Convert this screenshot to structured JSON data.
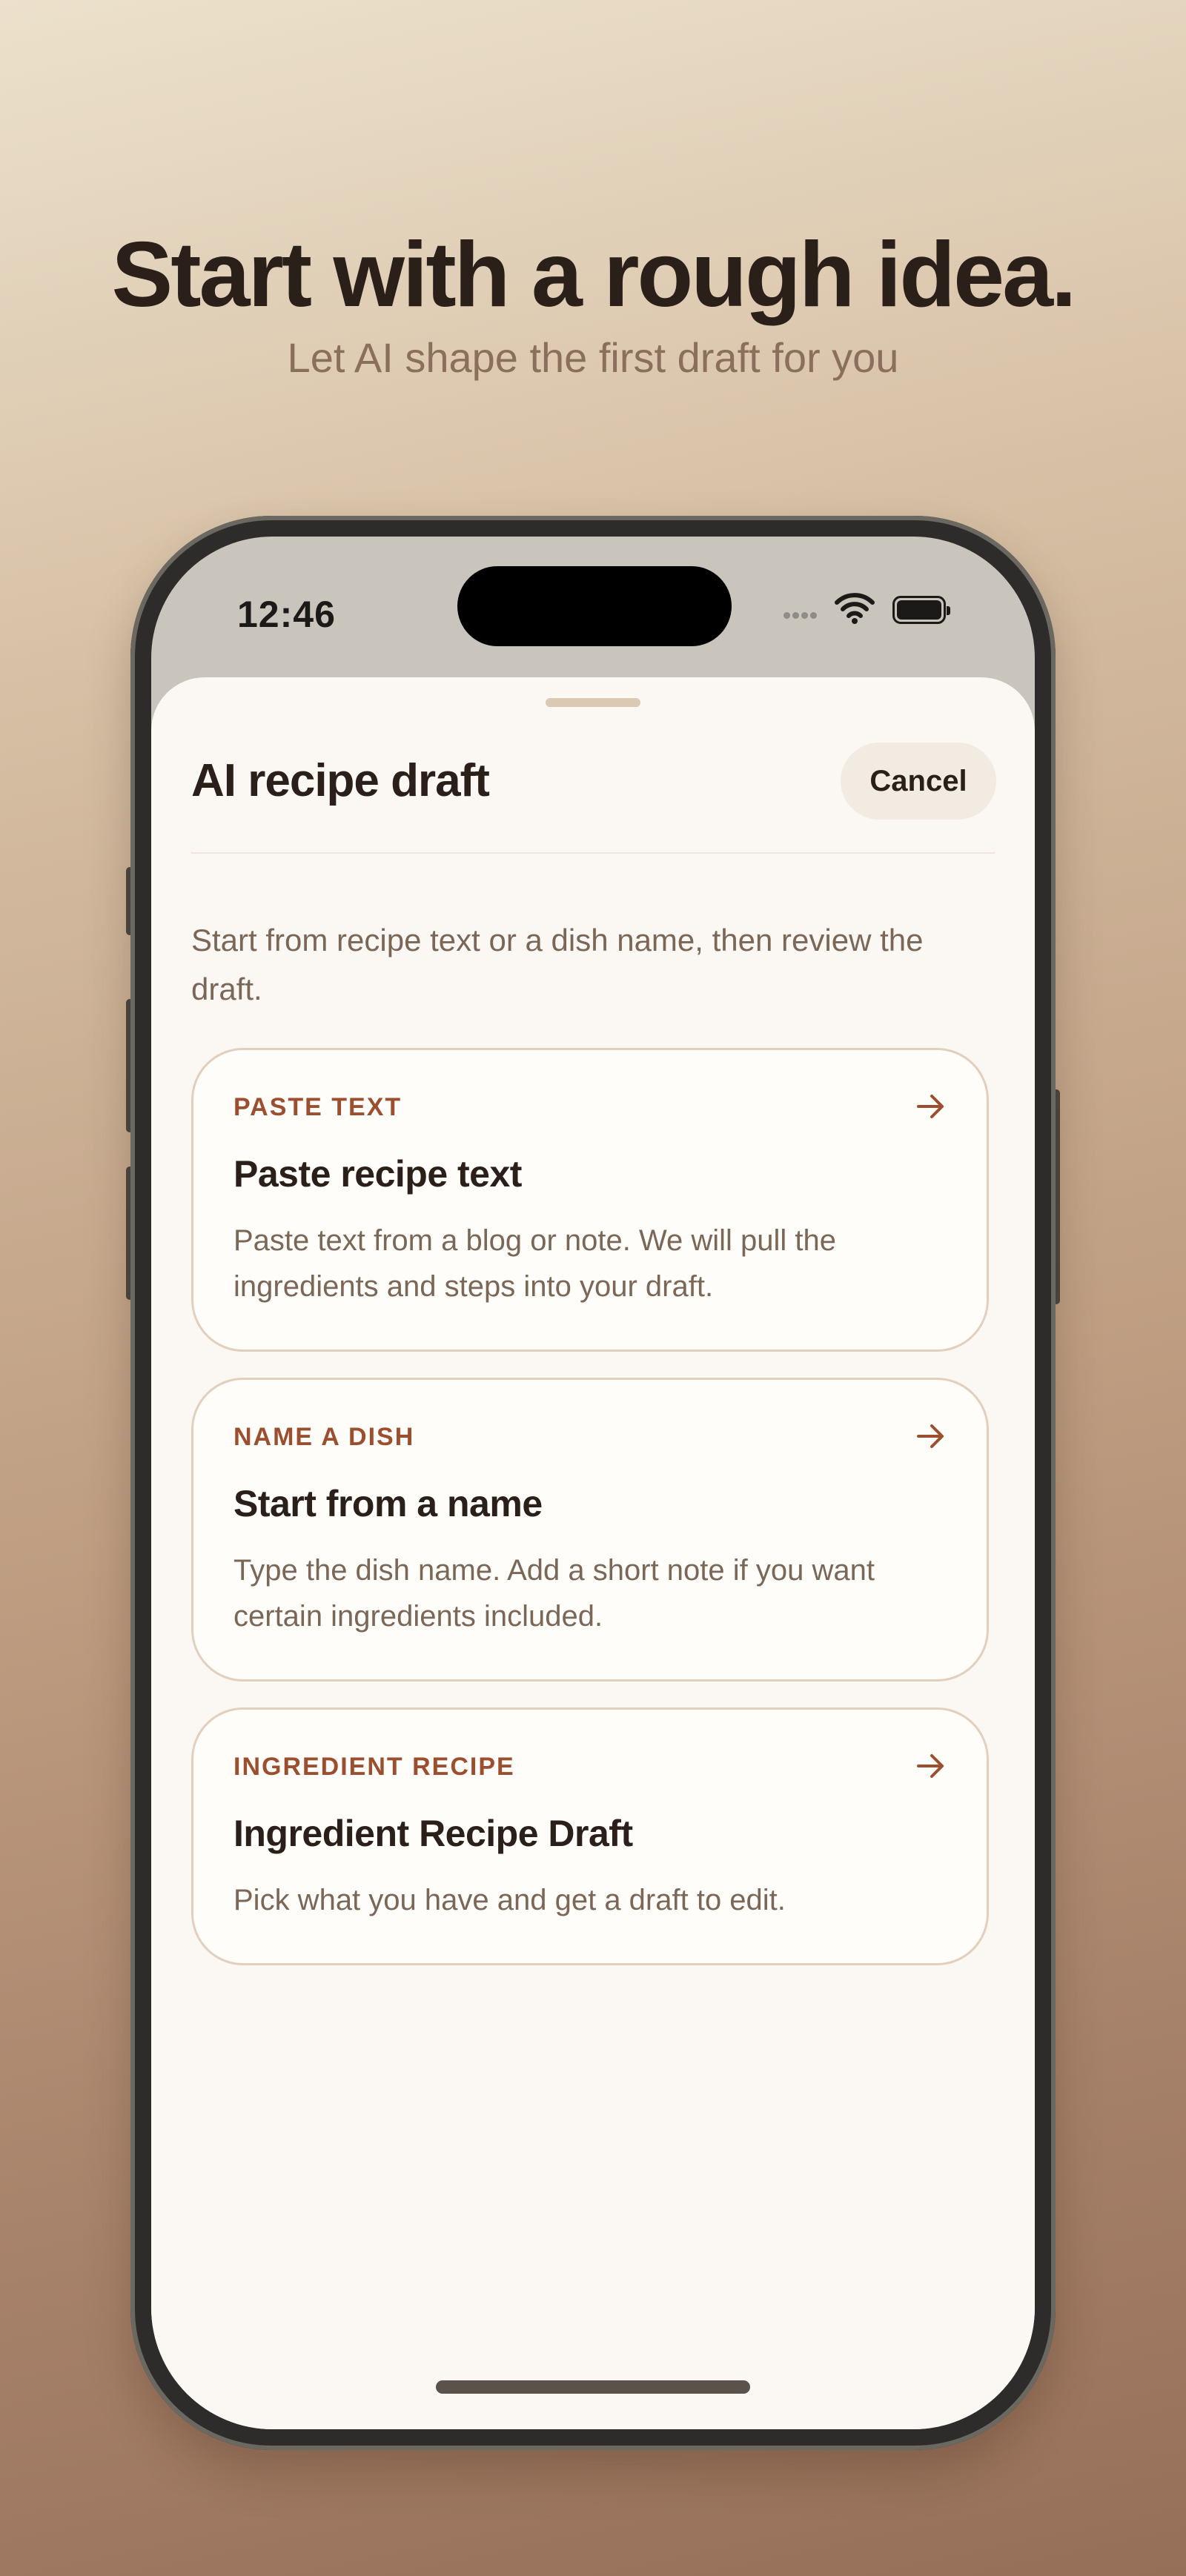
{
  "hero": {
    "title": "Start with a rough idea.",
    "subtitle": "Let AI shape the first draft for you"
  },
  "status_bar": {
    "time": "12:46",
    "icons": [
      "signal-icon",
      "wifi-icon",
      "battery-icon"
    ]
  },
  "sheet": {
    "title": "AI recipe draft",
    "cancel_label": "Cancel",
    "intro": "Start from recipe text or a dish name, then review the draft."
  },
  "options": [
    {
      "eyebrow": "PASTE TEXT",
      "title": "Paste recipe text",
      "description": "Paste text from a blog or note. We will pull the ingredients and steps into your draft.",
      "icon": "arrow-right-icon"
    },
    {
      "eyebrow": "NAME A DISH",
      "title": "Start from a name",
      "description": "Type the dish name. Add a short note if you want certain ingredients included.",
      "icon": "arrow-right-icon"
    },
    {
      "eyebrow": "INGREDIENT RECIPE",
      "title": "Ingredient Recipe Draft",
      "description": "Pick what you have and get a draft to edit.",
      "icon": "arrow-right-icon"
    }
  ],
  "colors": {
    "accent": "#9c4f2e",
    "text_primary": "#2a1f19",
    "text_secondary": "#7a6757",
    "sheet_background": "#fbf8f4",
    "card_border": "#e2cfbd"
  }
}
